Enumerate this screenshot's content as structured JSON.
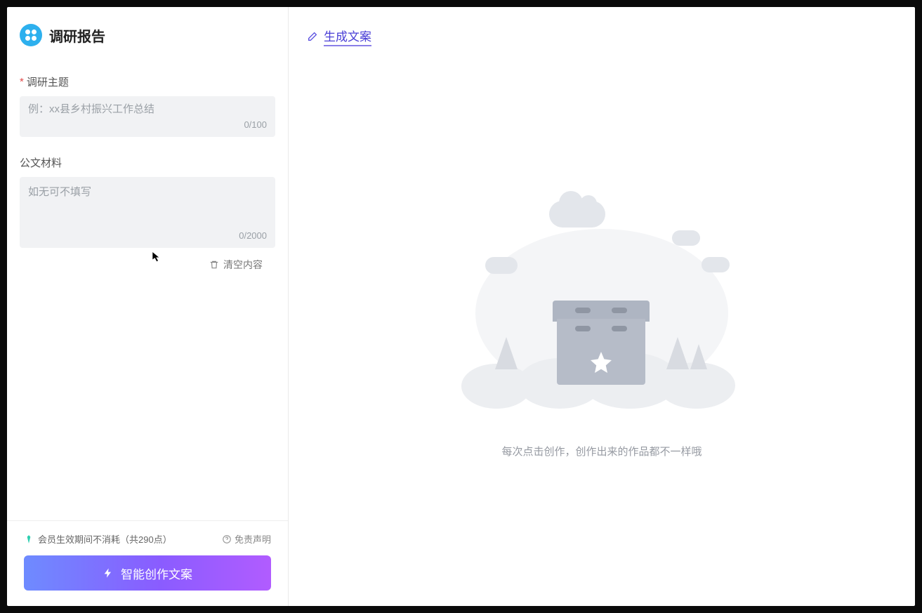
{
  "sidebar": {
    "title": "调研报告",
    "fields": {
      "topic": {
        "label": "调研主题",
        "required": true,
        "placeholder": "例：xx县乡村振兴工作总结",
        "value": "",
        "counter": "0/100"
      },
      "material": {
        "label": "公文材料",
        "required": false,
        "placeholder": "如无可不填写",
        "value": "",
        "counter": "0/2000"
      }
    },
    "clear_label": "清空内容"
  },
  "footer": {
    "credits_text": "会员生效期间不消耗（共290点）",
    "disclaimer_label": "免责声明",
    "generate_label": "智能创作文案"
  },
  "main": {
    "header_label": "生成文案",
    "empty_text": "每次点击创作，创作出来的作品都不一样哦"
  }
}
